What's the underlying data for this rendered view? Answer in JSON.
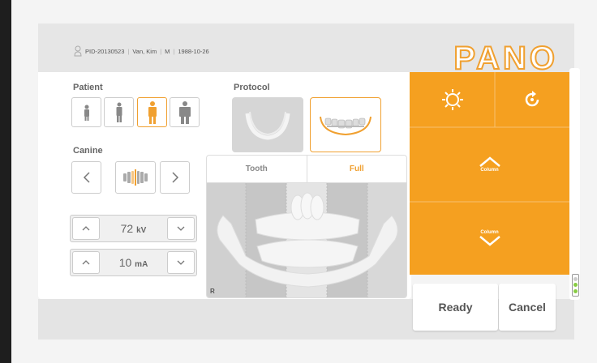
{
  "header": {
    "patient_id": "PID-20130523",
    "patient_name": "Van, Kim",
    "sex": "M",
    "dob": "1988-10-26",
    "separator": "|",
    "mode_title": "PANO"
  },
  "patient": {
    "label": "Patient",
    "sizes": [
      "child-small",
      "child",
      "adult",
      "adult-large"
    ],
    "selected_index": 2
  },
  "protocol": {
    "label": "Protocol",
    "options": [
      "arch-only",
      "full-arch"
    ],
    "selected_index": 1
  },
  "canine": {
    "label": "Canine",
    "prev": "<",
    "next": ">"
  },
  "kv": {
    "value": "72",
    "unit": "kV",
    "up": "^",
    "down": "v"
  },
  "ma": {
    "value": "10",
    "unit": "mA",
    "up": "^",
    "down": "v"
  },
  "view": {
    "tabs": [
      "Tooth",
      "Full"
    ],
    "active_tab": "Full",
    "side_marker": "R"
  },
  "controls": {
    "light_icon": "light-icon",
    "reset_icon": "rotate-reset-icon",
    "column_up_label": "Column",
    "column_down_label": "Column"
  },
  "actions": {
    "ready_label": "Ready",
    "cancel_label": "Cancel"
  },
  "colors": {
    "accent": "#f5a020",
    "active_border": "#f0a030",
    "text": "#555555"
  }
}
